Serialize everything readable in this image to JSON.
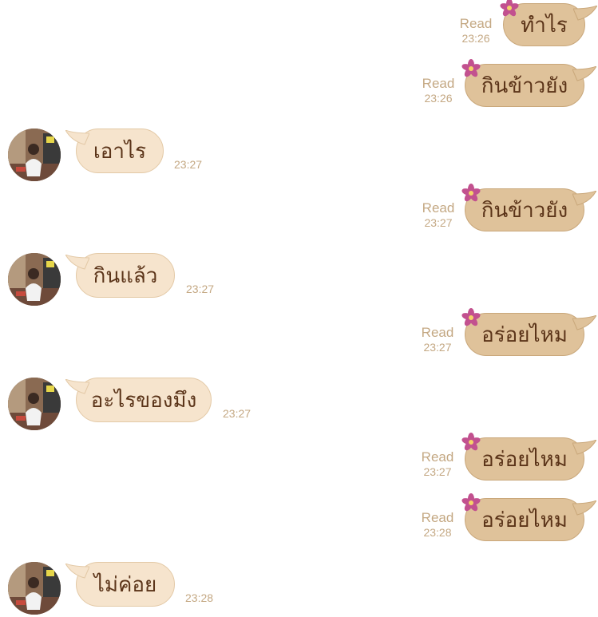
{
  "messages": [
    {
      "dir": "out",
      "text": "ทำไร",
      "read": "Read",
      "time": "23:26"
    },
    {
      "dir": "out",
      "text": "กินข้าวยัง",
      "read": "Read",
      "time": "23:26"
    },
    {
      "dir": "in",
      "text": "เอาไร",
      "time": "23:27"
    },
    {
      "dir": "out",
      "text": "กินข้าวยัง",
      "read": "Read",
      "time": "23:27"
    },
    {
      "dir": "in",
      "text": "กินแล้ว",
      "time": "23:27"
    },
    {
      "dir": "out",
      "text": "อร่อยไหม",
      "read": "Read",
      "time": "23:27"
    },
    {
      "dir": "in",
      "text": "อะไรของมึง",
      "time": "23:27"
    },
    {
      "dir": "out",
      "text": "อร่อยไหม",
      "read": "Read",
      "time": "23:27"
    },
    {
      "dir": "out",
      "text": "อร่อยไหม",
      "read": "Read",
      "time": "23:28"
    },
    {
      "dir": "in",
      "text": "ไม่ค่อย",
      "time": "23:28"
    }
  ],
  "colors": {
    "outgoing_bubble": "#dfc29a",
    "incoming_bubble": "#f6e4cd",
    "meta_text": "#c4a883",
    "message_text": "#5b3419",
    "flower": "#c2518f"
  },
  "icons": {
    "sticker": "flower-icon",
    "avatar": "avatar"
  }
}
